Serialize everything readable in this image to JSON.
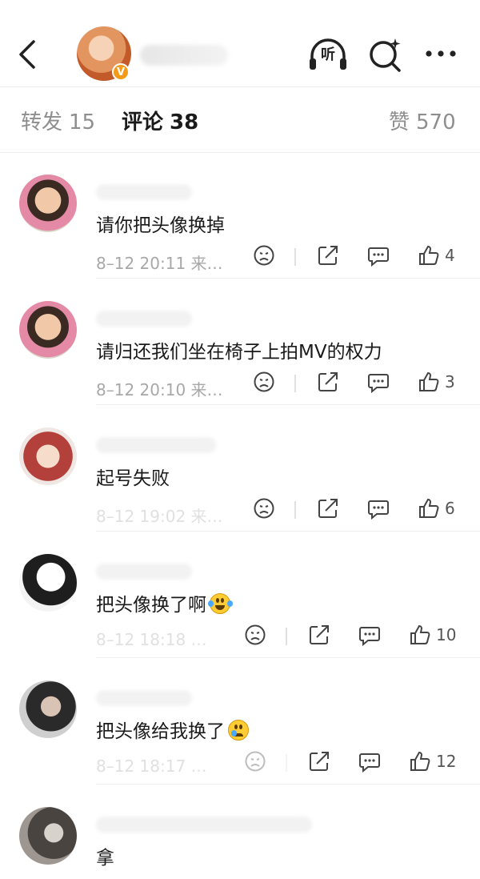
{
  "header": {
    "listen_label": "听",
    "verified_badge": "V"
  },
  "tabs": [
    {
      "label": "转发",
      "count": "15"
    },
    {
      "label": "评论",
      "count": "38"
    },
    {
      "label": "赞",
      "count": "570"
    }
  ],
  "comments": [
    {
      "text": "请你把头像换掉",
      "meta": "8–12 20:11 来…",
      "likes": "4",
      "emoji": ""
    },
    {
      "text": "请归还我们坐在椅子上拍MV的权力",
      "meta": "8–12 20:10 来…",
      "likes": "3",
      "emoji": ""
    },
    {
      "text": "起号失败",
      "meta": "8–12 19:02 来…",
      "likes": "6",
      "emoji": ""
    },
    {
      "text": "把头像换了啊",
      "meta": "8–12 18:18 …",
      "likes": "10",
      "emoji": "laugh-cry-emoji"
    },
    {
      "text": "把头像给我换了",
      "meta": "8–12 18:17 …",
      "likes": "12",
      "emoji": "cry-emoji"
    },
    {
      "text": "拿",
      "meta": "",
      "likes": "",
      "emoji": ""
    }
  ],
  "colors": {
    "accent_badge": "#f39b19",
    "text_primary": "#1a1a1a",
    "text_secondary": "#8e8e8e"
  }
}
